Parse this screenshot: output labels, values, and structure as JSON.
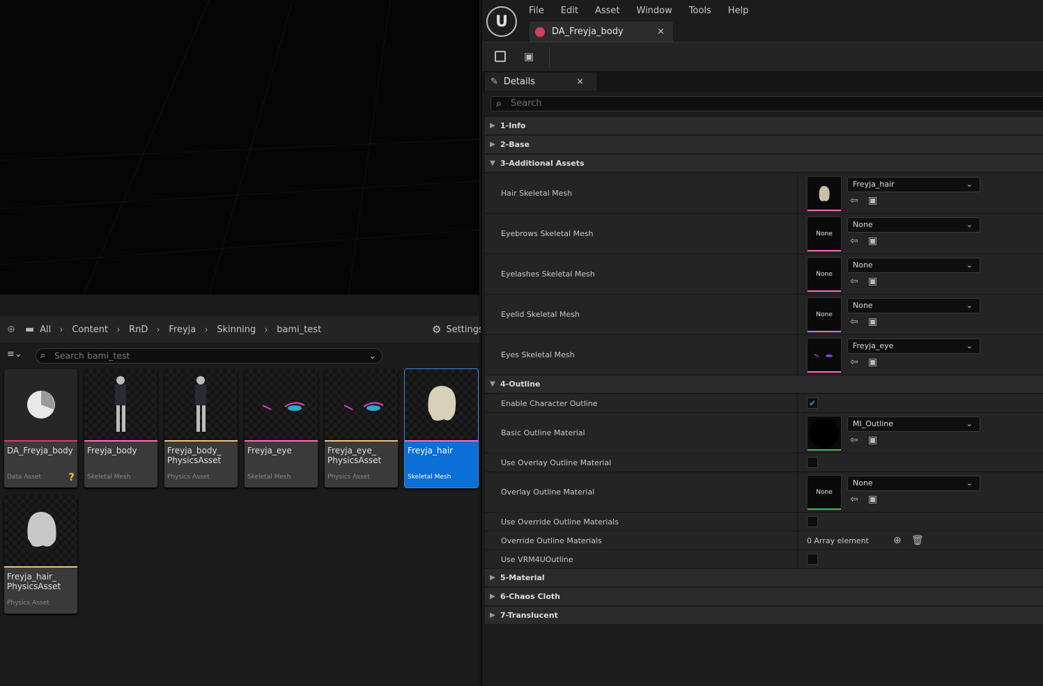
{
  "colors": {
    "accent": "#0a6fd6",
    "skeletal_mesh": "#ff66cc",
    "physics_asset": "#f0c080",
    "data_asset": "#d04060",
    "material": "#40c060"
  },
  "content_browser": {
    "breadcrumb": [
      "All",
      "Content",
      "RnD",
      "Freyja",
      "Skinning",
      "bami_test"
    ],
    "settings_label": "Settings",
    "search_placeholder": "Search bami_test",
    "assets": [
      {
        "name": "DA_Freyja_body",
        "type": "Data Asset",
        "icon": "data-asset-icon"
      },
      {
        "name": "Freyja_body",
        "type": "Skeletal Mesh"
      },
      {
        "name": "Freyja_body_ PhysicsAsset",
        "type": "Physics Asset"
      },
      {
        "name": "Freyja_eye",
        "type": "Skeletal Mesh"
      },
      {
        "name": "Freyja_eye_ PhysicsAsset",
        "type": "Physics Asset"
      },
      {
        "name": "Freyja_hair",
        "type": "Skeletal Mesh",
        "selected": true
      },
      {
        "name": "Freyja_hair_ PhysicsAsset",
        "type": "Physics Asset"
      }
    ]
  },
  "editor": {
    "menu": [
      "File",
      "Edit",
      "Asset",
      "Window",
      "Tools",
      "Help"
    ],
    "doc_tab": "DA_Freyja_body",
    "details_tab": "Details",
    "details_search_placeholder": "Search",
    "categories": {
      "c1": "1-Info",
      "c2": "2-Base",
      "c3": "3-Additional Assets",
      "c4": "4-Outline",
      "c5": "5-Material",
      "c6": "6-Chaos Cloth",
      "c7": "7-Translucent"
    },
    "props": {
      "hair": {
        "label": "Hair Skeletal Mesh",
        "value": "Freyja_hair"
      },
      "eyebrows": {
        "label": "Eyebrows Skeletal Mesh",
        "value": "None",
        "thumb": "None"
      },
      "eyelashes": {
        "label": "Eyelashes Skeletal Mesh",
        "value": "None",
        "thumb": "None"
      },
      "eyelid": {
        "label": "Eyelid Skeletal Mesh",
        "value": "None",
        "thumb": "None"
      },
      "eyes": {
        "label": "Eyes Skeletal Mesh",
        "value": "Freyja_eye"
      },
      "enable_outline": {
        "label": "Enable Character Outline",
        "checked": true
      },
      "basic_outline": {
        "label": "Basic Outline Material",
        "value": "MI_Outline"
      },
      "use_overlay": {
        "label": "Use Overlay Outline Material",
        "checked": false
      },
      "overlay_outline": {
        "label": "Overlay Outline Material",
        "value": "None",
        "thumb": "None"
      },
      "use_override": {
        "label": "Use Override Outline Materials",
        "checked": false
      },
      "override": {
        "label": "Override Outline Materials",
        "value": "0 Array element"
      },
      "use_vrm": {
        "label": "Use VRM4UOutline",
        "checked": false
      }
    }
  }
}
